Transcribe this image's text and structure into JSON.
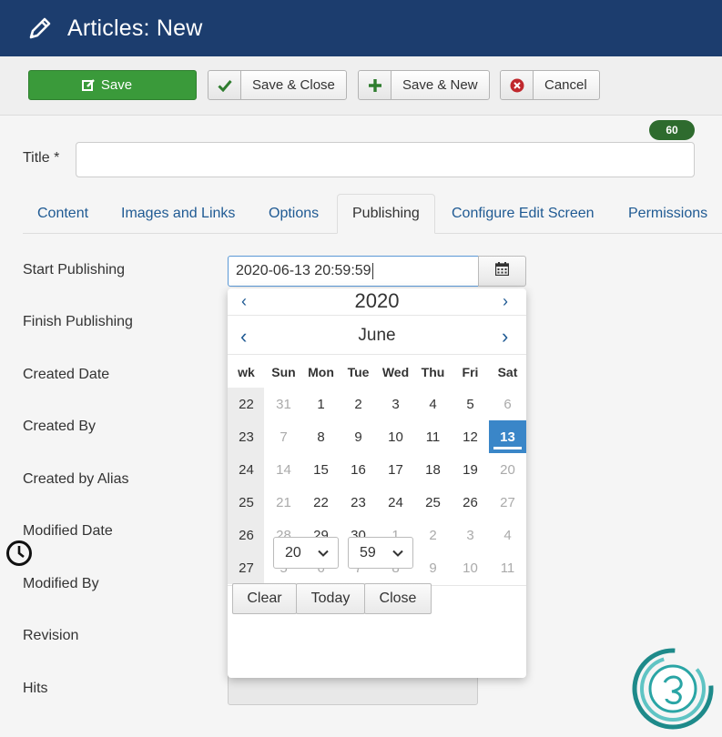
{
  "header": {
    "title": "Articles: New",
    "icon": "pencil-icon"
  },
  "toolbar": {
    "save": "Save",
    "save_close": "Save & Close",
    "save_new": "Save & New",
    "cancel": "Cancel",
    "save_color": "#3a9a3a"
  },
  "form": {
    "title_label": "Title *",
    "title_value": "",
    "char_count": "60"
  },
  "tabs": [
    "Content",
    "Images and Links",
    "Options",
    "Publishing",
    "Configure Edit Screen",
    "Permissions"
  ],
  "active_tab": "Publishing",
  "fields": {
    "start_publishing": "Start Publishing",
    "finish_publishing": "Finish Publishing",
    "created_date": "Created Date",
    "created_by": "Created By",
    "created_by_alias": "Created by Alias",
    "modified_date": "Modified Date",
    "modified_by": "Modified By",
    "revision": "Revision",
    "hits": "Hits"
  },
  "start_publishing_value": "2020-06-13 20:59:59",
  "calendar": {
    "year": "2020",
    "month": "June",
    "prev": "‹",
    "next": "›",
    "headers": [
      "wk",
      "Sun",
      "Mon",
      "Tue",
      "Wed",
      "Thu",
      "Fri",
      "Sat"
    ],
    "weeks": [
      {
        "wk": "22",
        "days": [
          "31",
          "1",
          "2",
          "3",
          "4",
          "5",
          "6"
        ]
      },
      {
        "wk": "23",
        "days": [
          "7",
          "8",
          "9",
          "10",
          "11",
          "12",
          "13"
        ]
      },
      {
        "wk": "24",
        "days": [
          "14",
          "15",
          "16",
          "17",
          "18",
          "19",
          "20"
        ]
      },
      {
        "wk": "25",
        "days": [
          "21",
          "22",
          "23",
          "24",
          "25",
          "26",
          "27"
        ]
      },
      {
        "wk": "26",
        "days": [
          "28",
          "29",
          "30",
          "1",
          "2",
          "3",
          "4"
        ]
      },
      {
        "wk": "27",
        "days": [
          "5",
          "6",
          "7",
          "8",
          "9",
          "10",
          "11"
        ]
      }
    ],
    "hour": "20",
    "minute": "59",
    "clear": "Clear",
    "today": "Today",
    "close": "Close",
    "selected_color": "#3a86c8"
  }
}
